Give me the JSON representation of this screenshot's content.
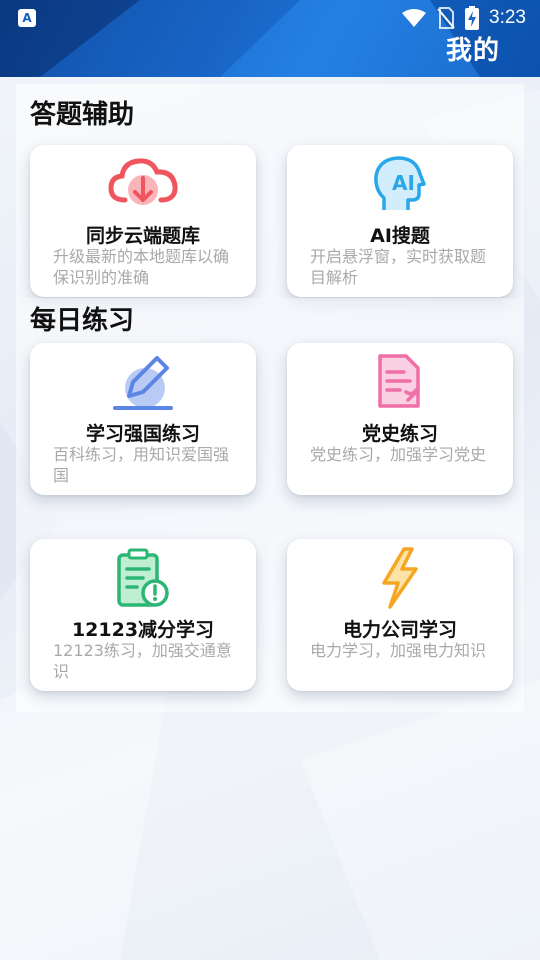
{
  "status_bar": {
    "app_badge": "A",
    "time": "3:23"
  },
  "header": {
    "title": "我的"
  },
  "sections": [
    {
      "title": "答题辅助",
      "cards": [
        {
          "title": "同步云端题库",
          "desc": "升级最新的本地题库以确保识别的准确",
          "icon": "cloud-download-icon",
          "color": "#f0545c"
        },
        {
          "title": "AI搜题",
          "desc": "开启悬浮窗，实时获取题目解析",
          "icon": "ai-head-icon",
          "color": "#2aa7e8"
        }
      ]
    },
    {
      "title": "每日练习",
      "cards": [
        {
          "title": "学习强国练习",
          "desc": "百科练习，用知识爱国强国",
          "icon": "pencil-icon",
          "color": "#5b86e5"
        },
        {
          "title": "党史练习",
          "desc": "党史练习，加强学习党史",
          "icon": "document-icon",
          "color": "#f06fa7"
        },
        {
          "title": "12123减分学习",
          "desc": "12123练习，加强交通意识",
          "icon": "clipboard-alert-icon",
          "color": "#2bb673"
        },
        {
          "title": "电力公司学习",
          "desc": "电力学习，加强电力知识",
          "icon": "lightning-icon",
          "color": "#f5a623"
        }
      ]
    }
  ]
}
